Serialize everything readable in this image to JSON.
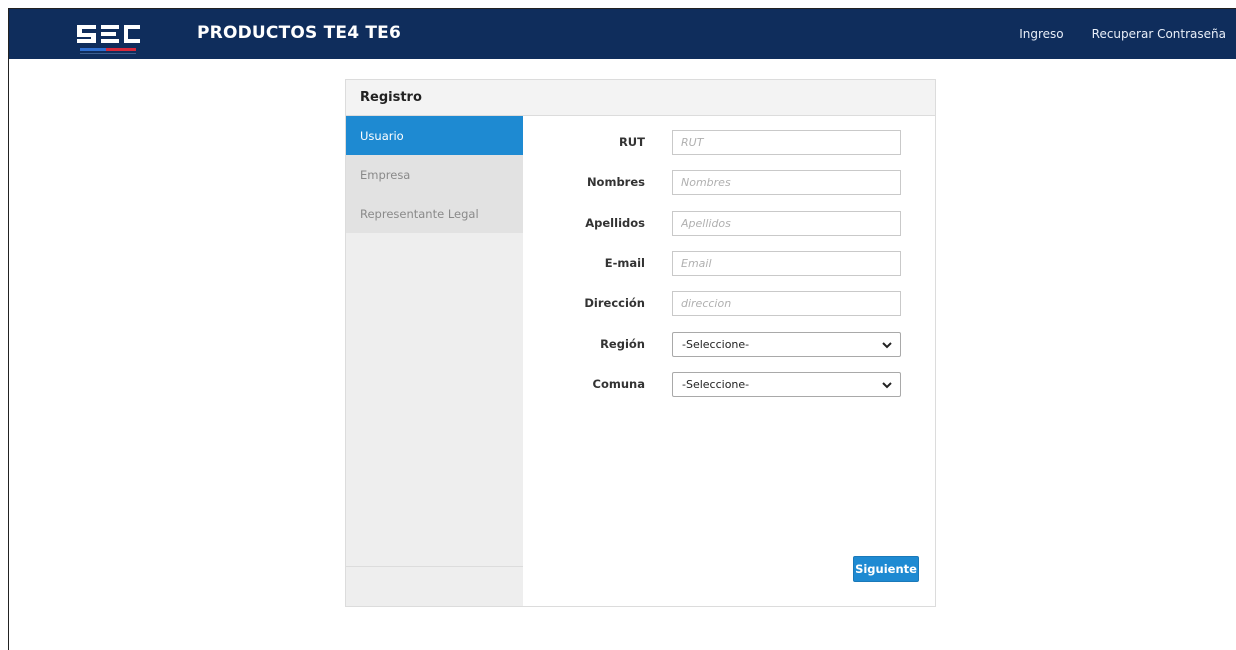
{
  "header": {
    "logo_text": "SEC",
    "title": "PRODUCTOS TE4 TE6",
    "links": [
      "Ingreso",
      "Recuperar Contraseña"
    ]
  },
  "panel": {
    "title": "Registro"
  },
  "sidebar": {
    "items": [
      {
        "label": "Usuario",
        "active": true
      },
      {
        "label": "Empresa",
        "active": false
      },
      {
        "label": "Representante Legal",
        "active": false
      }
    ]
  },
  "form": {
    "rut": {
      "label": "RUT",
      "placeholder": "RUT",
      "value": ""
    },
    "nombres": {
      "label": "Nombres",
      "placeholder": "Nombres",
      "value": ""
    },
    "apellidos": {
      "label": "Apellidos",
      "placeholder": "Apellidos",
      "value": ""
    },
    "email": {
      "label": "E-mail",
      "placeholder": "Email",
      "value": ""
    },
    "direccion": {
      "label": "Dirección",
      "placeholder": "direccion",
      "value": ""
    },
    "region": {
      "label": "Región",
      "selected": "-Seleccione-"
    },
    "comuna": {
      "label": "Comuna",
      "selected": "-Seleccione-"
    }
  },
  "actions": {
    "next_label": "Siguiente"
  },
  "colors": {
    "navbar": "#0f2d5c",
    "accent": "#1e8ad2",
    "logo_blue": "#2f6fd0",
    "logo_red": "#d6283a"
  }
}
